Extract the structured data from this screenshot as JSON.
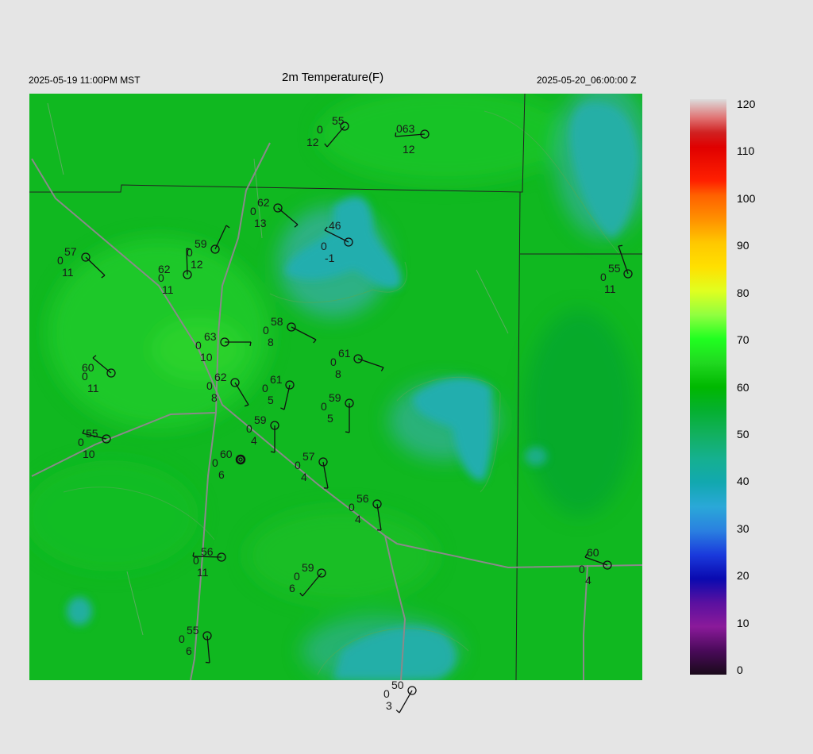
{
  "header": {
    "local_time": "2025-05-19 11:00PM MST",
    "title": "2m Temperature(F)",
    "valid_time": "2025-05-20_06:00:00 Z"
  },
  "colorbar": {
    "labels": [
      "120",
      "110",
      "100",
      "90",
      "80",
      "70",
      "60",
      "50",
      "40",
      "30",
      "20",
      "10",
      "0"
    ],
    "stops": [
      {
        "v": 0,
        "c": "#1a0a1a"
      },
      {
        "v": 5,
        "c": "#4a0a5a"
      },
      {
        "v": 10,
        "c": "#8a1a9a"
      },
      {
        "v": 15,
        "c": "#5a10a0"
      },
      {
        "v": 20,
        "c": "#0a0ab0"
      },
      {
        "v": 25,
        "c": "#1a3adc"
      },
      {
        "v": 30,
        "c": "#2a80e0"
      },
      {
        "v": 35,
        "c": "#2aa8d8"
      },
      {
        "v": 40,
        "c": "#12a8b0"
      },
      {
        "v": 45,
        "c": "#15b090"
      },
      {
        "v": 50,
        "c": "#12b060"
      },
      {
        "v": 55,
        "c": "#05b030"
      },
      {
        "v": 60,
        "c": "#00b800"
      },
      {
        "v": 65,
        "c": "#20d820"
      },
      {
        "v": 70,
        "c": "#20ff20"
      },
      {
        "v": 75,
        "c": "#90ff40"
      },
      {
        "v": 80,
        "c": "#e0ff20"
      },
      {
        "v": 85,
        "c": "#ffe000"
      },
      {
        "v": 90,
        "c": "#ffc800"
      },
      {
        "v": 95,
        "c": "#ff9000"
      },
      {
        "v": 100,
        "c": "#ff6000"
      },
      {
        "v": 103,
        "c": "#ff2000"
      },
      {
        "v": 110,
        "c": "#e00000"
      },
      {
        "v": 113,
        "c": "#d02020"
      },
      {
        "v": 116,
        "c": "#e07070"
      },
      {
        "v": 120,
        "c": "#dcdcdc"
      }
    ]
  },
  "stations": [
    {
      "t": "55",
      "d": "0",
      "dp": "12"
    },
    {
      "t": "063",
      "d": "",
      "dp": "12"
    },
    {
      "t": "62",
      "d": "0",
      "dp": "13"
    },
    {
      "t": "46",
      "d": "0",
      "dp": "-1"
    },
    {
      "t": "57",
      "d": "0",
      "dp": "11"
    },
    {
      "t": "59",
      "d": "0",
      "dp": "12"
    },
    {
      "t": "62",
      "d": "0",
      "dp": "11"
    },
    {
      "t": "55",
      "d": "0",
      "dp": "11"
    },
    {
      "t": "58",
      "d": "0",
      "dp": "8"
    },
    {
      "t": "63",
      "d": "0",
      "dp": "10"
    },
    {
      "t": "61",
      "d": "0",
      "dp": "8"
    },
    {
      "t": "60",
      "d": "0",
      "dp": "11"
    },
    {
      "t": "62",
      "d": "0",
      "dp": "8"
    },
    {
      "t": "61",
      "d": "0",
      "dp": "5"
    },
    {
      "t": "59",
      "d": "0",
      "dp": "5"
    },
    {
      "t": "59",
      "d": "0",
      "dp": "4"
    },
    {
      "t": "55",
      "d": "0",
      "dp": "10"
    },
    {
      "t": "60",
      "d": "0",
      "dp": "6"
    },
    {
      "t": "57",
      "d": "0",
      "dp": "4"
    },
    {
      "t": "56",
      "d": "0",
      "dp": "4"
    },
    {
      "t": "56",
      "d": "0",
      "dp": "11"
    },
    {
      "t": "60",
      "d": "0",
      "dp": "4"
    },
    {
      "t": "59",
      "d": "0",
      "dp": "6"
    },
    {
      "t": "55",
      "d": "0",
      "dp": "6"
    },
    {
      "t": "50",
      "d": "0",
      "dp": "3"
    }
  ]
}
